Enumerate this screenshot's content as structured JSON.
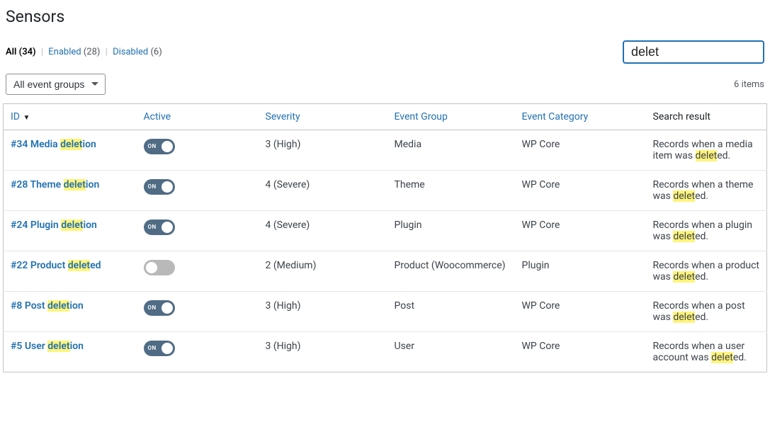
{
  "title": "Sensors",
  "filters": {
    "all": {
      "label": "All",
      "count": "(34)"
    },
    "enabled": {
      "label": "Enabled",
      "count": "(28)"
    },
    "disabled": {
      "label": "Disabled",
      "count": "(6)"
    }
  },
  "search": {
    "value": "delet"
  },
  "group_select": {
    "label": "All event groups"
  },
  "items_count": "6 items",
  "highlight_term": "delet",
  "columns": {
    "id": "ID",
    "active": "Active",
    "severity": "Severity",
    "group": "Event Group",
    "category": "Event Category",
    "result": "Search result"
  },
  "rows": [
    {
      "id": "#34 Media deletion",
      "active": true,
      "severity": "3 (High)",
      "group": "Media",
      "category": "WP Core",
      "result": "Records when a media item was deleted."
    },
    {
      "id": "#28 Theme deletion",
      "active": true,
      "severity": "4 (Severe)",
      "group": "Theme",
      "category": "WP Core",
      "result": "Records when a theme was deleted."
    },
    {
      "id": "#24 Plugin deletion",
      "active": true,
      "severity": "4 (Severe)",
      "group": "Plugin",
      "category": "WP Core",
      "result": "Records when a plugin was deleted."
    },
    {
      "id": "#22 Product deleted",
      "active": false,
      "severity": "2 (Medium)",
      "group": "Product (Woocommerce)",
      "category": "Plugin",
      "result": "Records when a product was deleted."
    },
    {
      "id": "#8 Post deletion",
      "active": true,
      "severity": "3 (High)",
      "group": "Post",
      "category": "WP Core",
      "result": "Records when a post was deleted."
    },
    {
      "id": "#5 User deletion",
      "active": true,
      "severity": "3 (High)",
      "group": "User",
      "category": "WP Core",
      "result": "Records when a user account was deleted."
    }
  ]
}
